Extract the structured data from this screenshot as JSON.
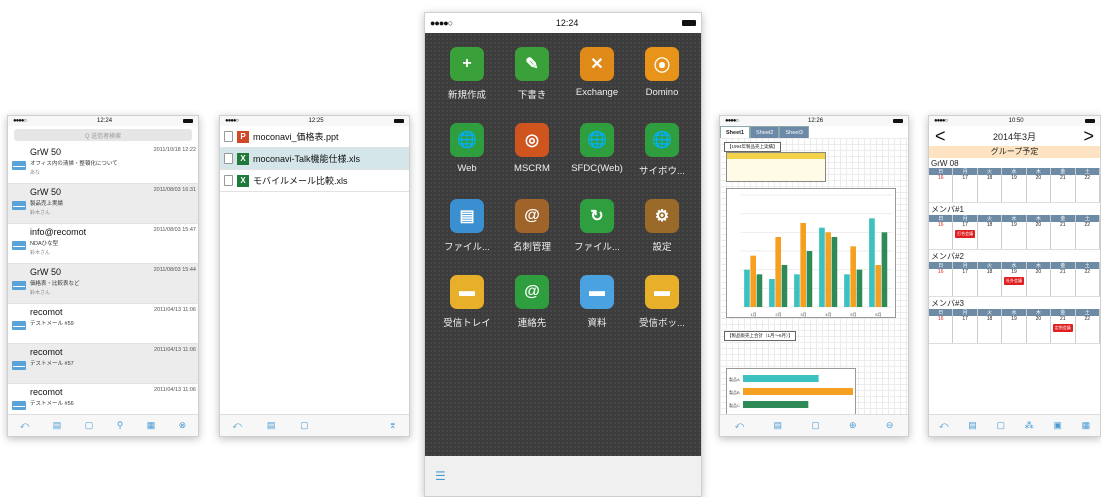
{
  "phone1": {
    "time": "12:24",
    "search_placeholder": "Q 送信者検索",
    "mails": [
      {
        "from": "GrW 50",
        "date": "2011/10/18 12:22",
        "subject": "オフィス内の清掃・整頓化について",
        "who": "あな"
      },
      {
        "from": "GrW 50",
        "date": "2011/08/03 16:31",
        "subject": "製品売上実績",
        "who": "鈴木さん"
      },
      {
        "from": "info@recomot",
        "date": "2011/08/03 15:47",
        "subject": "NDAひな型",
        "who": "鈴木さん"
      },
      {
        "from": "GrW 50",
        "date": "2011/08/03 15:44",
        "subject": "価格表・比較表など",
        "who": "鈴木さん"
      },
      {
        "from": "recomot",
        "date": "2011/04/13 11:06",
        "subject": "テストメール #59",
        "who": ""
      },
      {
        "from": "recomot",
        "date": "2011/04/13 11:06",
        "subject": "テストメール #57",
        "who": ""
      },
      {
        "from": "recomot",
        "date": "2011/04/13 11:06",
        "subject": "テストメール #56",
        "who": ""
      }
    ]
  },
  "phone2": {
    "time": "12:25",
    "files": [
      {
        "type": "P",
        "name": "moconavi_価格表.ppt"
      },
      {
        "type": "X",
        "name": "moconavi-Talk機能仕様.xls"
      },
      {
        "type": "X",
        "name": "モバイルメール比較.xls"
      }
    ]
  },
  "phone3": {
    "time": "12:24",
    "apps": [
      {
        "label": "新規作成",
        "color": "#3aa13a",
        "glyph": "+"
      },
      {
        "label": "下書き",
        "color": "#3aa13a",
        "glyph": "✎"
      },
      {
        "label": "Exchange",
        "color": "#e08a1a",
        "glyph": "✕"
      },
      {
        "label": "Domino",
        "color": "#e8941a",
        "glyph": "⦿"
      },
      {
        "label": "Web",
        "color": "#2e9e3e",
        "glyph": "🌐"
      },
      {
        "label": "MSCRM",
        "color": "#d0541e",
        "glyph": "◎"
      },
      {
        "label": "SFDC(Web)",
        "color": "#2e9e3e",
        "glyph": "🌐"
      },
      {
        "label": "サイボウ...",
        "color": "#2e9e3e",
        "glyph": "🌐"
      },
      {
        "label": "ファイル...",
        "color": "#3a8fd0",
        "glyph": "▤"
      },
      {
        "label": "名刺管理",
        "color": "#a0642a",
        "glyph": "@"
      },
      {
        "label": "ファイル...",
        "color": "#2e9e3e",
        "glyph": "↻"
      },
      {
        "label": "設定",
        "color": "#9a6a2a",
        "glyph": "⚙"
      },
      {
        "label": "受信トレイ",
        "color": "#e8b02a",
        "glyph": "▬"
      },
      {
        "label": "連絡先",
        "color": "#2e9e3e",
        "glyph": "@"
      },
      {
        "label": "資料",
        "color": "#4aa3e0",
        "glyph": "▬"
      },
      {
        "label": "受信ボッ...",
        "color": "#e8b02a",
        "glyph": "▬"
      }
    ]
  },
  "phone4": {
    "time": "12:26",
    "tabs": [
      "Sheet1",
      "Sheet2",
      "Sheet3"
    ],
    "title1": "【1994年製品売上実績】",
    "title2": "【製品販売上合計（1月〜6月）】",
    "chart_data": [
      {
        "type": "bar",
        "categories": [
          "1月",
          "2月",
          "3月",
          "4月",
          "5月",
          "6月"
        ],
        "series": [
          {
            "values": [
              40,
              30,
              35,
              85,
              35,
              95
            ]
          },
          {
            "values": [
              55,
              75,
              90,
              80,
              65,
              45
            ]
          },
          {
            "values": [
              35,
              45,
              60,
              75,
              40,
              80
            ]
          }
        ],
        "colors": [
          "#3cc0c0",
          "#f5a020",
          "#2e8b57"
        ],
        "ylim": [
          0,
          120
        ]
      },
      {
        "type": "bar",
        "categories": [
          "製品A",
          "製品B",
          "製品C"
        ],
        "values": [
          110,
          160,
          95
        ],
        "colors": [
          "#3cc0c0",
          "#f5a020",
          "#2e8b57"
        ]
      }
    ]
  },
  "phone5": {
    "time": "10:50",
    "month": "2014年3月",
    "group": "グループ予定",
    "weekdays": [
      "日",
      "月",
      "火",
      "水",
      "木",
      "金",
      "土"
    ],
    "days": [
      "16",
      "17",
      "18",
      "19",
      "20",
      "21",
      "22"
    ],
    "rows": [
      {
        "name": "GrW 08",
        "event": "",
        "event_day": -1
      },
      {
        "name": "メンバ#1",
        "event": "打合会議",
        "event_day": 1
      },
      {
        "name": "メンバ#2",
        "event": "社外会議",
        "event_day": 3
      },
      {
        "name": "メンバ#3",
        "event": "定例会議",
        "event_day": 5
      }
    ]
  }
}
